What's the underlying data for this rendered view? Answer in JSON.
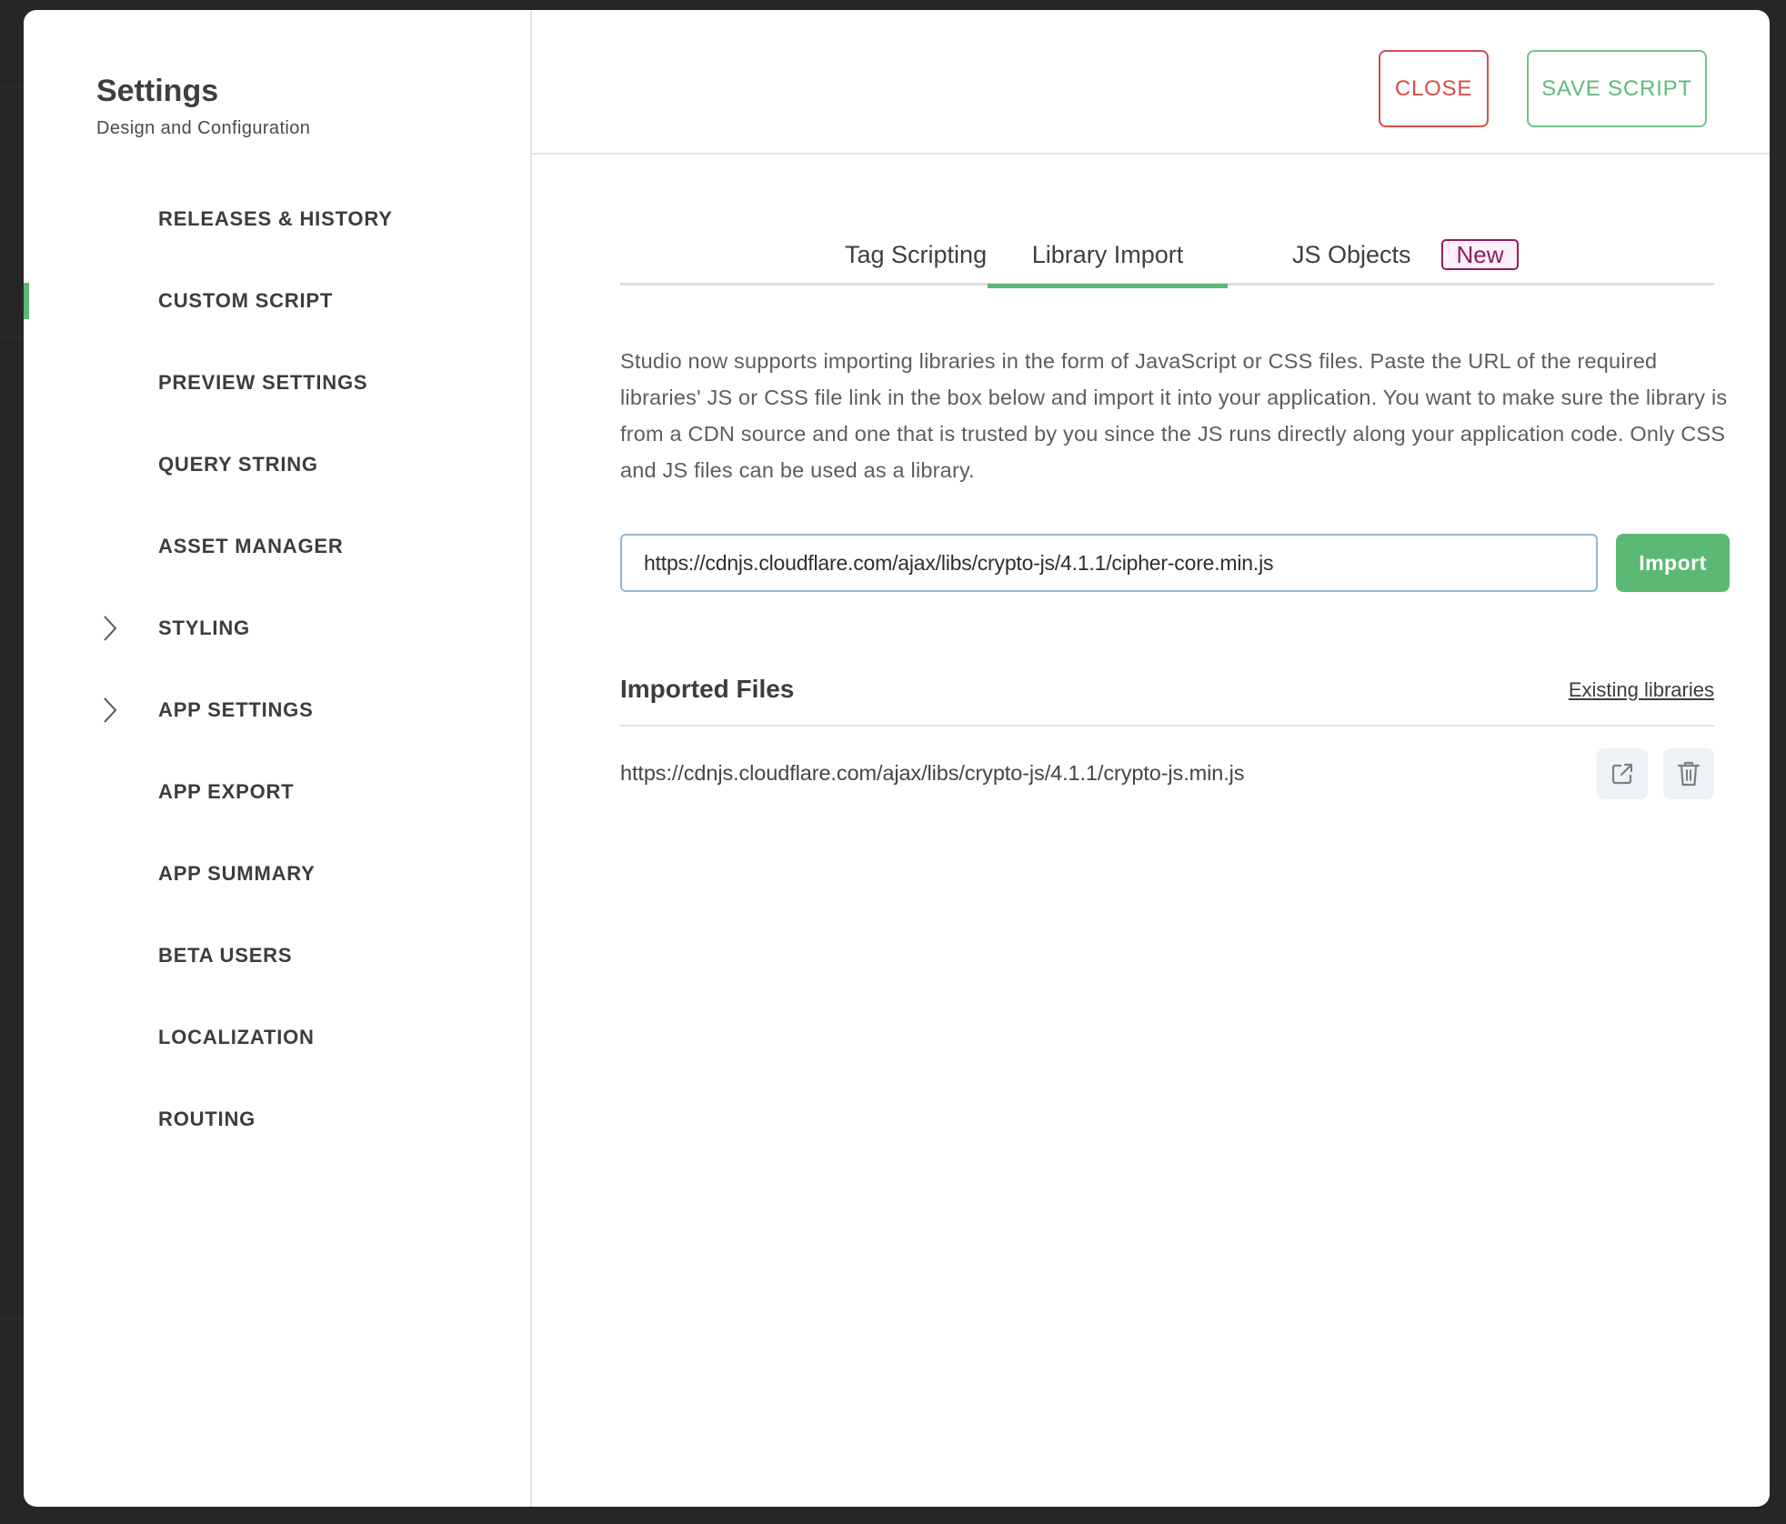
{
  "sidebar": {
    "title": "Settings",
    "subtitle": "Design and Configuration",
    "items": [
      {
        "label": "RELEASES & HISTORY",
        "active": false,
        "expandable": false
      },
      {
        "label": "CUSTOM SCRIPT",
        "active": true,
        "expandable": false
      },
      {
        "label": "PREVIEW SETTINGS",
        "active": false,
        "expandable": false
      },
      {
        "label": "QUERY STRING",
        "active": false,
        "expandable": false
      },
      {
        "label": "ASSET MANAGER",
        "active": false,
        "expandable": false
      },
      {
        "label": "STYLING",
        "active": false,
        "expandable": true
      },
      {
        "label": "APP SETTINGS",
        "active": false,
        "expandable": true
      },
      {
        "label": "APP EXPORT",
        "active": false,
        "expandable": false
      },
      {
        "label": "APP SUMMARY",
        "active": false,
        "expandable": false
      },
      {
        "label": "BETA USERS",
        "active": false,
        "expandable": false
      },
      {
        "label": "LOCALIZATION",
        "active": false,
        "expandable": false
      },
      {
        "label": "ROUTING",
        "active": false,
        "expandable": false
      }
    ]
  },
  "header": {
    "close_label": "CLOSE",
    "save_label": "SAVE SCRIPT"
  },
  "tabs": {
    "items": [
      {
        "label": "Tag Scripting",
        "active": false
      },
      {
        "label": "Library Import",
        "active": true
      },
      {
        "label": "JS Objects",
        "active": false,
        "badge": "New"
      }
    ]
  },
  "library_import": {
    "description": "Studio now supports importing libraries in the form of JavaScript or CSS files. Paste the URL of the required libraries' JS or CSS file link in the box below and import it into your application. You want to make sure the library is from a CDN source and one that is trusted by you since the JS runs directly along your application code. Only CSS and JS files can be used as a library.",
    "url_value": "https://cdnjs.cloudflare.com/ajax/libs/crypto-js/4.1.1/cipher-core.min.js",
    "import_label": "Import",
    "imported_title": "Imported Files",
    "existing_link": "Existing libraries",
    "files": [
      {
        "url": "https://cdnjs.cloudflare.com/ajax/libs/crypto-js/4.1.1/crypto-js.min.js",
        "actions": [
          "open-external-icon",
          "trash-icon"
        ]
      }
    ]
  },
  "colors": {
    "accent_green": "#5cb974",
    "close_red": "#d24e4a",
    "badge_purple": "#8f1d5e",
    "input_border": "#93b7d6"
  }
}
